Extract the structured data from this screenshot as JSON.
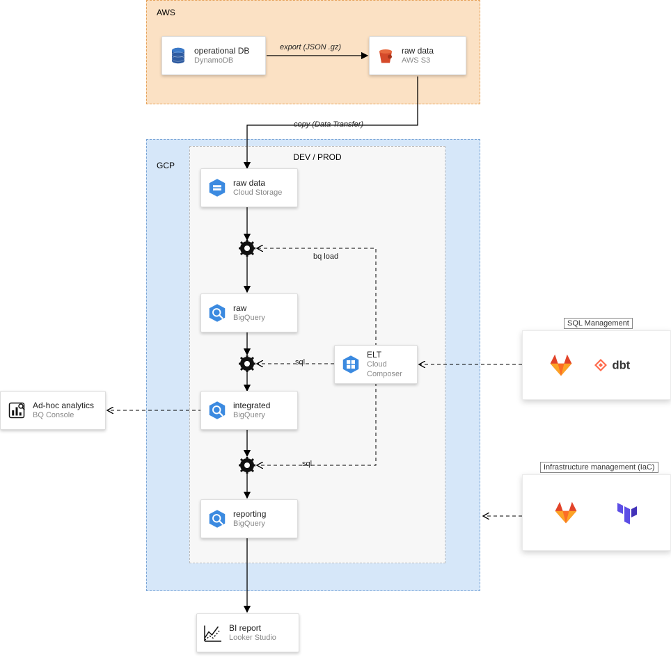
{
  "regions": {
    "aws": {
      "label": "AWS"
    },
    "gcp": {
      "label": "GCP"
    },
    "devprod": {
      "label": "DEV / PROD"
    }
  },
  "nodes": {
    "dynamodb": {
      "title": "operational DB",
      "sub": "DynamoDB"
    },
    "s3": {
      "title": "raw data",
      "sub": "AWS S3"
    },
    "gcs": {
      "title": "raw data",
      "sub": "Cloud Storage"
    },
    "bq_raw": {
      "title": "raw",
      "sub": "BigQuery"
    },
    "bq_int": {
      "title": "integrated",
      "sub": "BigQuery"
    },
    "bq_rep": {
      "title": "reporting",
      "sub": "BigQuery"
    },
    "composer": {
      "title": "ELT",
      "sub": "Cloud Composer"
    },
    "adhoc": {
      "title": "Ad-hoc analytics",
      "sub": "BQ Console"
    },
    "looker": {
      "title": "BI report",
      "sub": "Looker Studio"
    }
  },
  "edges": {
    "export": {
      "label": "export (JSON .gz)"
    },
    "copy": {
      "label": "copy (Data Transfer)"
    },
    "bqload": {
      "label": "bq load"
    },
    "sql1": {
      "label": "sql"
    },
    "sql2": {
      "label": "sql"
    }
  },
  "sidebars": {
    "sqlmgmt": {
      "caption": "SQL Management"
    },
    "iac": {
      "caption": "Infrastructure management (IaC)"
    }
  }
}
